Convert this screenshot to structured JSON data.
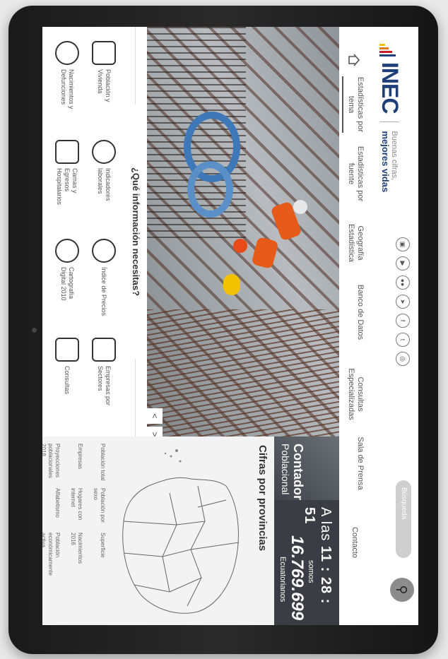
{
  "brand": {
    "logo": "INEC",
    "tagline_1": "Buenas cifras,",
    "tagline_2": "mejores vidas",
    "bar_colors": [
      "#f2c200",
      "#e07a10",
      "#c81e2d",
      "#1f3f7a"
    ]
  },
  "social_icons": [
    "app-icon",
    "youtube-icon",
    "flickr-icon",
    "telegram-icon",
    "facebook-icon",
    "twitter-icon",
    "instagram-icon"
  ],
  "search": {
    "placeholder": "Búsqueda"
  },
  "nav": [
    {
      "label": "Estadísticas por tema"
    },
    {
      "label": "Estadísticas por fuente"
    },
    {
      "label": "Geografía Estadística"
    },
    {
      "label": "Banco de Datos"
    },
    {
      "label": "Consultas Especializadas"
    },
    {
      "label": "Sala de Prensa"
    },
    {
      "label": "Contacto"
    }
  ],
  "hero": {
    "prev": "<",
    "next": ">"
  },
  "counter": {
    "title": "Contador",
    "subtitle": "Poblacional",
    "time_prefix": "A las",
    "time": "11 : 28 : 51",
    "somos": "somos",
    "number": "16.769.699",
    "unit": "Ecuatorianos"
  },
  "provinces": {
    "title": "Cifras por provincias",
    "stats": [
      "Población total",
      "Población por sexo",
      "Superficie",
      "Empresas",
      "Hogares con internet",
      "Nacimientos 2016",
      "Proyecciones poblacionales 2018",
      "Alfabetismo",
      "Población económicamente activa"
    ]
  },
  "info": {
    "title": "¿Qué información necesitas?",
    "tiles": [
      {
        "label": "Población y Vivienda",
        "icon": "buildings-icon"
      },
      {
        "label": "Indicadores laborales",
        "icon": "worker-icon"
      },
      {
        "label": "Índice de Precios",
        "icon": "globe-money-icon"
      },
      {
        "label": "Empresas por Sectores",
        "icon": "chart-icon"
      },
      {
        "label": "Nacimientos y Defunciones",
        "icon": "baby-icon"
      },
      {
        "label": "Camas y Egresos Hospitalarios",
        "icon": "hospital-icon"
      },
      {
        "label": "Cartografía Digital 2010",
        "icon": "map-outline-icon"
      },
      {
        "label": "Consultas",
        "icon": "people-network-icon"
      }
    ]
  }
}
